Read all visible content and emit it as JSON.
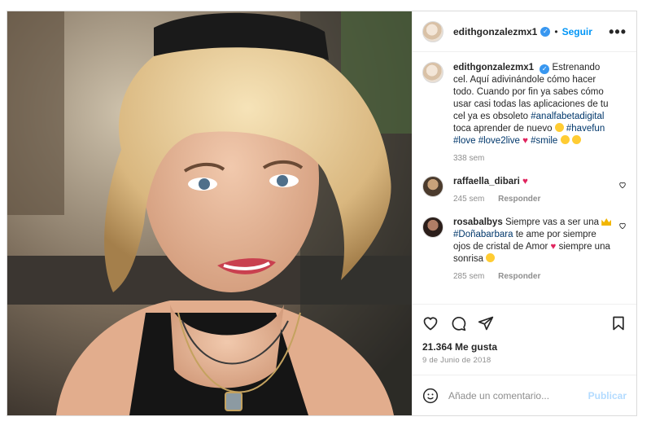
{
  "post": {
    "username": "edithgonzalezmx1",
    "follow_label": "Seguir",
    "more_label": "•••",
    "caption": {
      "text_1": "Estrenando cel. Aquí adivinándole cómo hacer todo. Cuando por fin ya sabes cómo usar casi todas las aplicaciones de tu cel ya es obsoleto ",
      "tag_1": "#analfabetadigital",
      "text_2": " toca aprender de nuevo",
      "tag_2": "#havefun",
      "tag_3": "#love",
      "tag_4": "#love2live",
      "tag_5": "#smile",
      "time": "338 sem"
    },
    "comments": [
      {
        "username": "raffaella_dibari",
        "time": "245 sem",
        "reply": "Responder"
      },
      {
        "username": "rosabalbys",
        "text_1": "Siempre vas a ser una",
        "tag": "#Doñabarbara",
        "text_2": "te ame por siempre ojos de cristal de Amor",
        "text_3": "siempre una sonrisa",
        "time": "285 sem",
        "reply": "Responder"
      }
    ],
    "likes": "21.364 Me gusta",
    "date": "9 de Junio de 2018",
    "add_comment_placeholder": "Añade un comentario...",
    "publish_label": "Publicar"
  },
  "colors": {
    "link": "#0095f6",
    "hashtag": "#00376b",
    "heart": "#e0245e",
    "muted": "#8e8e8e"
  }
}
